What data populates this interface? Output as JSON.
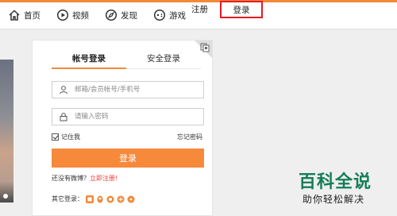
{
  "nav": {
    "items": [
      {
        "label": "首页",
        "icon": "home-icon"
      },
      {
        "label": "视频",
        "icon": "video-play-icon"
      },
      {
        "label": "发现",
        "icon": "compass-icon"
      },
      {
        "label": "游戏",
        "icon": "gamepad-icon"
      }
    ],
    "register_label": "注册",
    "login_label": "登录"
  },
  "login_card": {
    "tabs": [
      "帐号登录",
      "安全登录"
    ],
    "username_placeholder": "邮箱/会员帐号/手机号",
    "password_placeholder": "请输入密码",
    "remember_label": "记住我",
    "forgot_label": "忘记密码",
    "login_button": "登录",
    "no_account_text": "还没有微博？",
    "register_link": "立即注册!",
    "other_login_label": "其它登录："
  },
  "watermark": {
    "title": "百科全说",
    "subtitle": "助你轻松解决"
  },
  "colors": {
    "accent": "#f7893b",
    "highlight_box": "#e21c23",
    "watermark": "#157d57"
  }
}
